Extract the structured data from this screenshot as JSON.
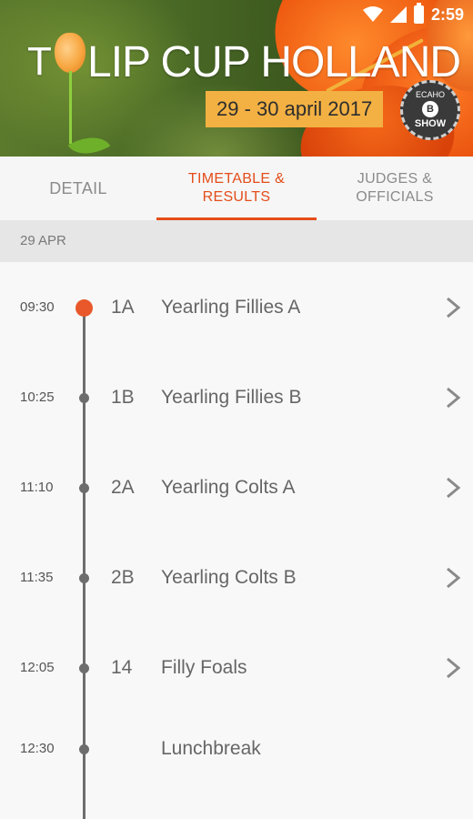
{
  "status_bar": {
    "time": "2:59"
  },
  "banner": {
    "title_prefix": "T",
    "title_rest": "LIP CUP HOLLAND",
    "dates": "29 - 30 april 2017",
    "badge": {
      "top": "ECAHO",
      "middle": "B",
      "bottom": "SHOW"
    }
  },
  "tabs": [
    {
      "label": "DETAIL",
      "active": false
    },
    {
      "label": "TIMETABLE &\nRESULTS",
      "active": true
    },
    {
      "label": "JUDGES &\nOFFICIALS",
      "active": false
    }
  ],
  "date_header": "29 APR",
  "schedule": [
    {
      "time": "09:30",
      "code": "1A",
      "name": "Yearling Fillies A",
      "has_chevron": true,
      "highlight": true
    },
    {
      "time": "10:25",
      "code": "1B",
      "name": "Yearling Fillies B",
      "has_chevron": true,
      "highlight": false
    },
    {
      "time": "11:10",
      "code": "2A",
      "name": "Yearling Colts A",
      "has_chevron": true,
      "highlight": false
    },
    {
      "time": "11:35",
      "code": "2B",
      "name": "Yearling Colts B",
      "has_chevron": true,
      "highlight": false
    },
    {
      "time": "12:05",
      "code": "14",
      "name": "Filly Foals",
      "has_chevron": true,
      "highlight": false
    },
    {
      "time": "12:30",
      "code": "",
      "name": "Lunchbreak",
      "has_chevron": false,
      "highlight": false
    }
  ],
  "colors": {
    "accent": "#e44d1a",
    "timeline": "#6d6d6d",
    "highlight_dot": "#e8582a"
  },
  "icons": {
    "chevron": "chevron-right-icon",
    "wifi": "wifi-icon",
    "signal": "signal-icon",
    "battery": "battery-icon"
  }
}
